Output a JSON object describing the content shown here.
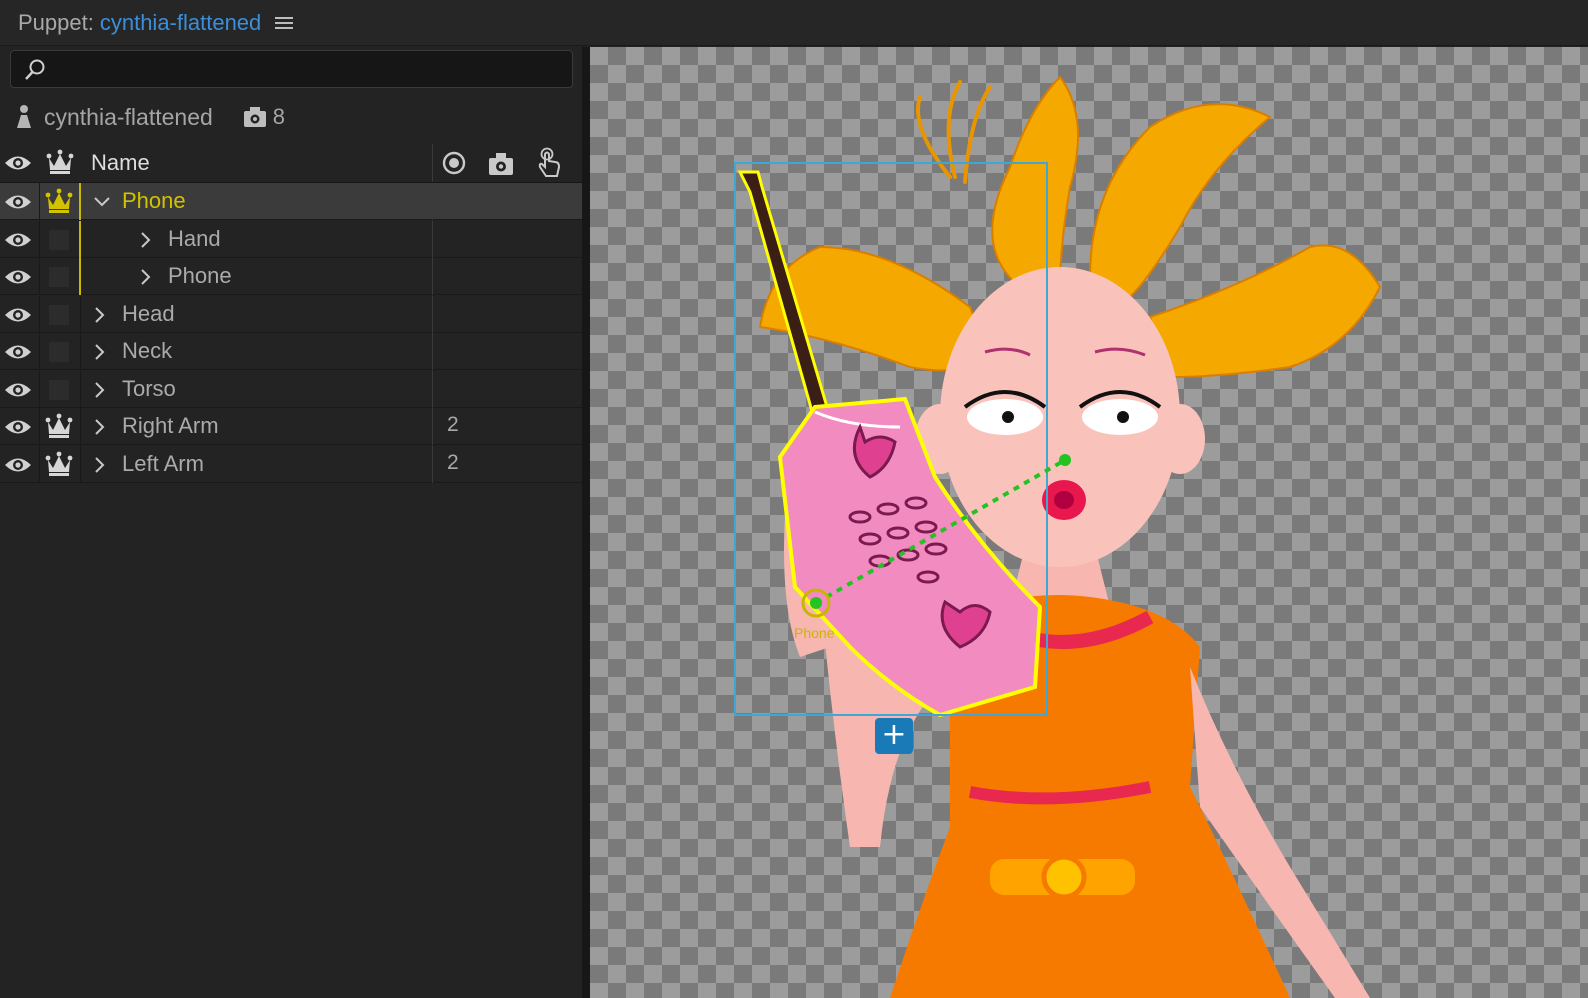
{
  "header": {
    "label": "Puppet:",
    "puppet_name": "cynthia-flattened",
    "menu_icon": "hamburger-menu-icon"
  },
  "search": {
    "value": "",
    "placeholder": ""
  },
  "puppet_info": {
    "name": "cynthia-flattened",
    "handle_count": "8"
  },
  "columns": {
    "name": "Name"
  },
  "layers": [
    {
      "label": "Phone",
      "expanded": true,
      "selected": true,
      "crown": true,
      "count": "",
      "indent": 1
    },
    {
      "label": "Hand",
      "expanded": false,
      "selected": false,
      "crown": false,
      "count": "",
      "indent": 2
    },
    {
      "label": "Phone",
      "expanded": false,
      "selected": false,
      "crown": false,
      "count": "",
      "indent": 2
    },
    {
      "label": "Head",
      "expanded": false,
      "selected": false,
      "crown": false,
      "count": "",
      "indent": 1
    },
    {
      "label": "Neck",
      "expanded": false,
      "selected": false,
      "crown": false,
      "count": "",
      "indent": 1
    },
    {
      "label": "Torso",
      "expanded": false,
      "selected": false,
      "crown": false,
      "count": "",
      "indent": 1
    },
    {
      "label": "Right Arm",
      "expanded": false,
      "selected": false,
      "crown": true,
      "count": "2",
      "indent": 1
    },
    {
      "label": "Left Arm",
      "expanded": false,
      "selected": false,
      "crown": true,
      "count": "2",
      "indent": 1
    }
  ],
  "canvas": {
    "handle_label": "Phone",
    "add_button": "+"
  },
  "colors": {
    "accent_blue": "#3a8edb",
    "selection_yellow": "#d2c200",
    "bounding_box": "#3fa7d6",
    "handle_link": "#22c322"
  }
}
